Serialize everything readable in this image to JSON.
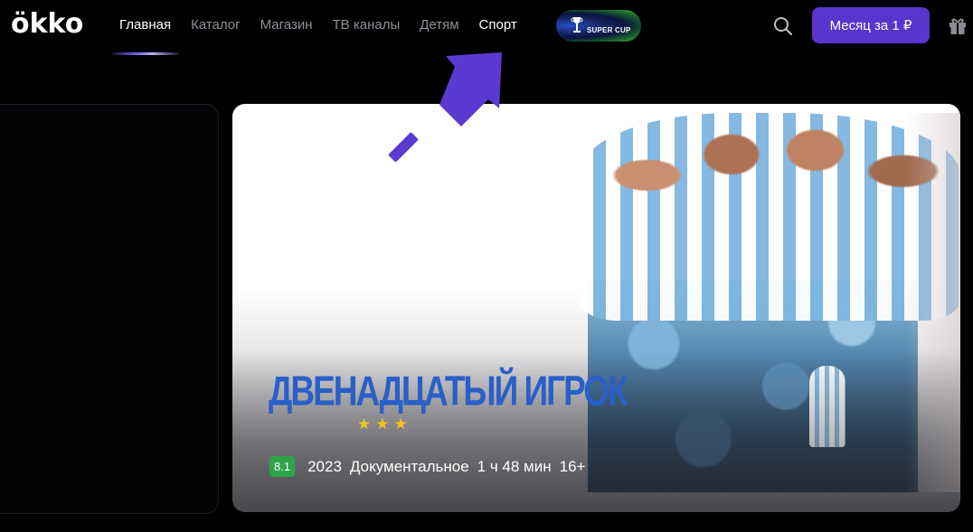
{
  "brand": {
    "logo": "ökko"
  },
  "nav": {
    "items": [
      {
        "label": "Главная"
      },
      {
        "label": "Каталог"
      },
      {
        "label": "Магазин"
      },
      {
        "label": "ТВ каналы"
      },
      {
        "label": "Детям"
      },
      {
        "label": "Спорт"
      }
    ],
    "supercup_label": "SUPER CUP"
  },
  "header": {
    "subscribe_label": "Месяц за 1 ₽",
    "search_icon": "search-icon",
    "gift_icon": "gift-icon"
  },
  "banner": {
    "title": "ДВЕНАДЦАТЫЙ ИГРОК",
    "stars": "★★★",
    "rating": "8.1",
    "year": "2023",
    "genre": "Документальное",
    "duration": "1 ч 48 мин",
    "age": "16+"
  },
  "colors": {
    "accent": "#5a34cc",
    "arrow": "#5b3ad1",
    "rating_bg": "#2fa34a",
    "title_blue": "#2a5fc8"
  }
}
